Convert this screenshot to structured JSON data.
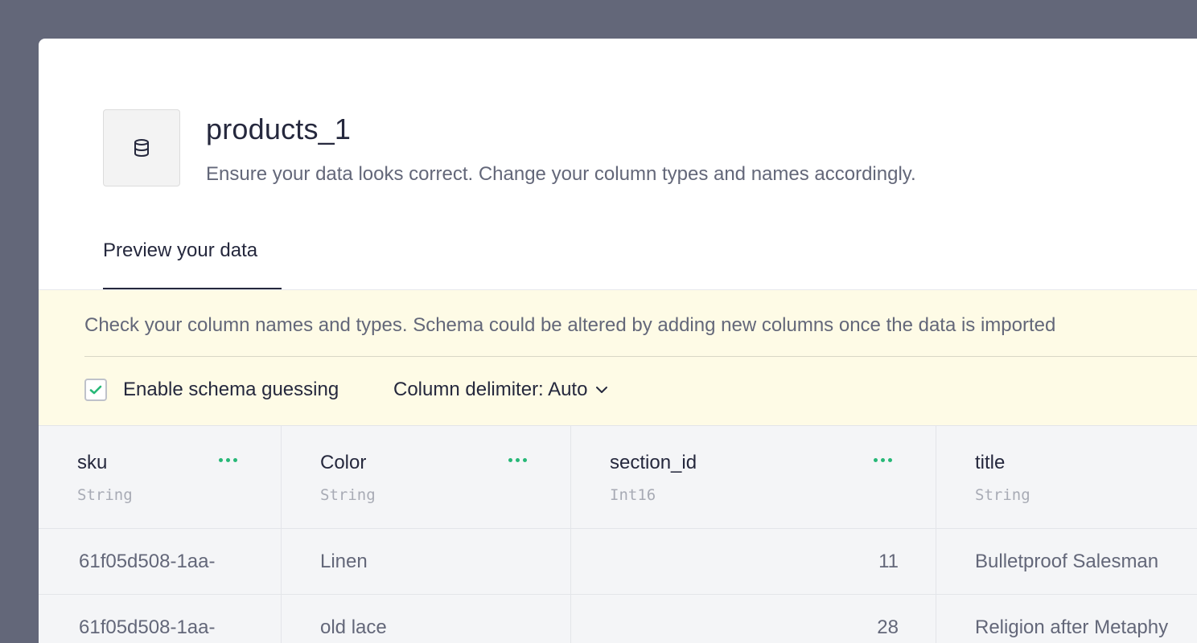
{
  "header": {
    "title": "products_1",
    "subtitle": "Ensure your data looks correct. Change your column types and names accordingly.",
    "icon": "database-icon"
  },
  "tabs": [
    {
      "label": "Preview your data",
      "active": true
    }
  ],
  "notice": {
    "text": "Check your column names and types. Schema could be altered by adding new columns once the data is imported",
    "schema_guessing_label": "Enable schema guessing",
    "schema_guessing_checked": true,
    "delimiter_label": "Column delimiter: Auto"
  },
  "colors": {
    "accent": "#27b877",
    "text_primary": "#25283d",
    "text_secondary": "#636779",
    "notice_bg": "#fefbe6",
    "backdrop": "#636779"
  },
  "table": {
    "columns": [
      {
        "name": "sku",
        "type": "String"
      },
      {
        "name": "Color",
        "type": "String"
      },
      {
        "name": "section_id",
        "type": "Int16"
      },
      {
        "name": "title",
        "type": "String"
      }
    ],
    "rows": [
      [
        "61f05d508-1aa-",
        "Linen",
        "11",
        "Bulletproof Salesman"
      ],
      [
        "61f05d508-1aa-",
        "old lace",
        "28",
        "Religion after Metaphy"
      ]
    ]
  }
}
